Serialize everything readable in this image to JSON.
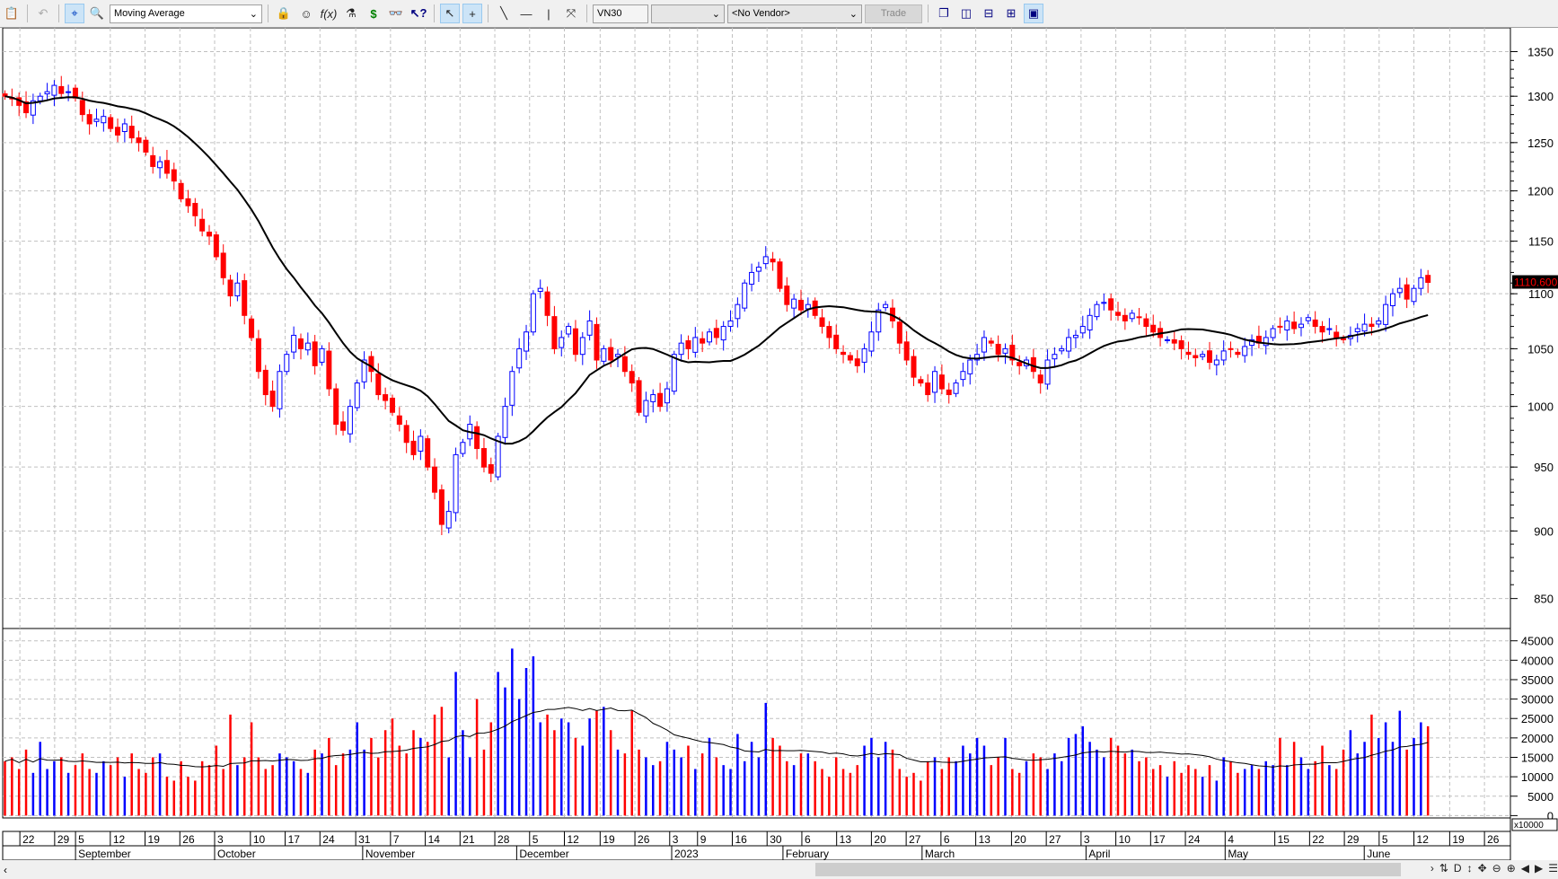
{
  "toolbar": {
    "indicator_select": "Moving Average",
    "symbol_input": "VN30",
    "interval_select": "",
    "vendor_select": "<No Vendor>",
    "trade_button": "Trade",
    "icons": [
      "paste-icon",
      "undo-icon",
      "crosshair-icon",
      "zoom-icon",
      "indicator-icon",
      "expert-icon",
      "function-icon",
      "lab-icon",
      "dollar-icon",
      "binoculars-icon",
      "help-icon",
      "pointer-icon",
      "cross-icon",
      "trendline-icon",
      "horizontal-line-icon",
      "vertical-line-icon",
      "fibonacci-icon",
      "windows-icon",
      "layout-icons"
    ]
  },
  "colors": {
    "up": "#0000ff",
    "down": "#ff0000",
    "ma": "#000000",
    "grid": "#c0c0c0"
  },
  "price_axis": {
    "ticks": [
      "1350",
      "1300",
      "1250",
      "1200",
      "1150",
      "1100",
      "1050",
      "1000",
      "950",
      "900",
      "850"
    ],
    "last_price": "1110.600",
    "scale": "log"
  },
  "volume_axis": {
    "ticks": [
      "45000",
      "40000",
      "35000",
      "30000",
      "25000",
      "20000",
      "15000",
      "10000",
      "5000",
      "0"
    ],
    "multiplier": "x10000"
  },
  "date_axis": {
    "days": [
      "22",
      "29",
      "5",
      "12",
      "19",
      "26",
      "3",
      "10",
      "17",
      "24",
      "31",
      "7",
      "14",
      "21",
      "28",
      "5",
      "12",
      "19",
      "26",
      "3",
      "9",
      "16",
      "30",
      "6",
      "13",
      "20",
      "27",
      "6",
      "13",
      "20",
      "27",
      "3",
      "10",
      "17",
      "24",
      "4",
      "15",
      "22",
      "29",
      "5",
      "12",
      "19",
      "26"
    ],
    "months": [
      "September",
      "October",
      "November",
      "December",
      "2023",
      "February",
      "March",
      "April",
      "May",
      "June"
    ]
  },
  "chart_data": {
    "type": "candlestick",
    "symbol": "VN30",
    "indicator": "Moving Average",
    "ylim": [
      850,
      1360
    ],
    "close": [
      1300,
      1297,
      1290,
      1282,
      1295,
      1300,
      1305,
      1312,
      1303,
      1305,
      1298,
      1280,
      1270,
      1275,
      1278,
      1265,
      1258,
      1270,
      1255,
      1250,
      1240,
      1225,
      1230,
      1218,
      1210,
      1192,
      1185,
      1175,
      1160,
      1155,
      1135,
      1115,
      1098,
      1110,
      1080,
      1060,
      1030,
      1010,
      1000,
      1030,
      1045,
      1062,
      1050,
      1055,
      1035,
      1050,
      1015,
      985,
      980,
      1000,
      1020,
      1040,
      1030,
      1010,
      1005,
      995,
      985,
      970,
      960,
      975,
      950,
      930,
      905,
      915,
      960,
      970,
      985,
      965,
      950,
      945,
      975,
      1000,
      1030,
      1050,
      1065,
      1100,
      1105,
      1080,
      1050,
      1060,
      1070,
      1045,
      1060,
      1075,
      1040,
      1050,
      1040,
      1045,
      1030,
      1020,
      995,
      1005,
      1010,
      1000,
      1015,
      1045,
      1055,
      1050,
      1060,
      1055,
      1065,
      1060,
      1070,
      1075,
      1090,
      1110,
      1120,
      1125,
      1135,
      1130,
      1105,
      1090,
      1095,
      1085,
      1090,
      1080,
      1070,
      1060,
      1050,
      1045,
      1040,
      1035,
      1050,
      1065,
      1085,
      1090,
      1075,
      1055,
      1040,
      1025,
      1020,
      1010,
      1030,
      1015,
      1010,
      1020,
      1030,
      1040,
      1045,
      1060,
      1055,
      1045,
      1050,
      1040,
      1035,
      1040,
      1030,
      1020,
      1040,
      1045,
      1050,
      1060,
      1062,
      1070,
      1080,
      1090,
      1092,
      1085,
      1080,
      1075,
      1082,
      1078,
      1070,
      1065,
      1060,
      1058,
      1055,
      1050,
      1045,
      1042,
      1045,
      1038,
      1040,
      1048,
      1050,
      1045,
      1052,
      1058,
      1055,
      1060,
      1068,
      1070,
      1075,
      1068,
      1072,
      1078,
      1070,
      1065,
      1068,
      1060,
      1058,
      1062,
      1068,
      1072,
      1070,
      1075,
      1090,
      1100,
      1105,
      1095,
      1105,
      1115,
      1110.6
    ],
    "volume": [
      14000,
      15000,
      12000,
      17000,
      11000,
      19000,
      12000,
      14000,
      15000,
      11000,
      13000,
      16000,
      12000,
      11000,
      14000,
      13000,
      15000,
      10000,
      16000,
      12000,
      11000,
      15000,
      16000,
      10000,
      9000,
      14000,
      10000,
      9000,
      14000,
      13000,
      18000,
      12000,
      26000,
      13000,
      15000,
      24000,
      15000,
      12000,
      13000,
      16000,
      15000,
      14000,
      12000,
      11000,
      17000,
      16000,
      20000,
      13000,
      16000,
      17000,
      24000,
      17000,
      20000,
      15000,
      22000,
      25000,
      18000,
      16000,
      22000,
      20000,
      19000,
      26000,
      28000,
      15000,
      37000,
      22000,
      15000,
      30000,
      17000,
      24000,
      37000,
      33000,
      43000,
      30000,
      38000,
      41000,
      24000,
      26000,
      22000,
      25000,
      24000,
      20000,
      18000,
      25000,
      27000,
      28000,
      22000,
      17000,
      16000,
      27000,
      17000,
      15000,
      13000,
      14000,
      19000,
      17000,
      15000,
      18000,
      12000,
      16000,
      20000,
      15000,
      13000,
      12000,
      21000,
      14000,
      19000,
      15000,
      29000,
      20000,
      18000,
      14000,
      13000,
      16000,
      16000,
      14000,
      12000,
      10000,
      15000,
      12000,
      11000,
      13000,
      18000,
      20000,
      15000,
      19000,
      17000,
      12000,
      10000,
      11000,
      9000,
      14000,
      15000,
      12000,
      15000,
      14000,
      18000,
      16000,
      20000,
      18000,
      13000,
      15000,
      20000,
      12000,
      11000,
      14000,
      16000,
      15000,
      12000,
      16000,
      14000,
      20000,
      21000,
      23000,
      19000,
      17000,
      15000,
      20000,
      18000,
      16000,
      17000,
      14000,
      15000,
      12000,
      13000,
      10000,
      14000,
      11000,
      13000,
      12000,
      10000,
      13000,
      9000,
      15000,
      14000,
      11000,
      12000,
      13000,
      12000,
      14000,
      13000,
      20000,
      13000,
      19000,
      15000,
      12000,
      14000,
      18000,
      13000,
      12000,
      17000,
      22000,
      16000,
      19000,
      26000,
      20000,
      24000,
      19000,
      27000,
      17000,
      20000,
      24000,
      23000
    ]
  }
}
